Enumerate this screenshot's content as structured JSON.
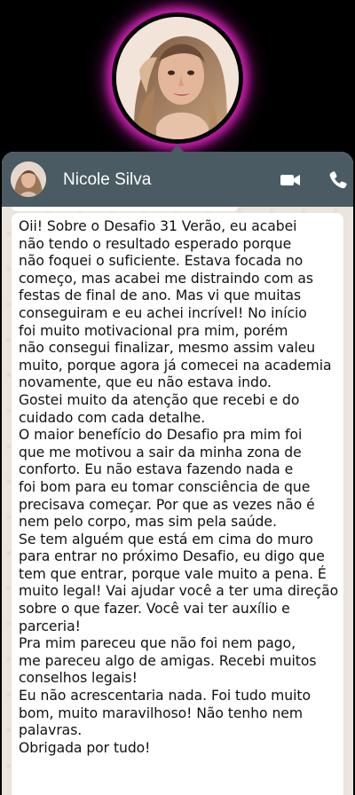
{
  "profile": {
    "photo_icon": "woman-portrait-photo",
    "glow_color": "#d11fb4"
  },
  "header": {
    "contact_name": "Nicole Silva",
    "background_color": "#4a5b63",
    "video_icon": "video-camera-icon",
    "call_icon": "phone-icon"
  },
  "chat": {
    "background_color": "#ece5dd",
    "bubble_color": "#ffffff",
    "message": "Oii! Sobre o Desafio 31 Verão, eu acabei\nnão tendo o resultado esperado porque\nnão foquei o suficiente. Estava focada no\ncomeço, mas acabei me distraindo com as\nfestas de final de ano. Mas vi que muitas\nconseguiram e eu achei incrível! No início\nfoi muito motivacional pra mim, porém\nnão consegui finalizar, mesmo assim valeu\nmuito, porque agora já comecei na academia\nnovamente, que eu não estava indo.\nGostei muito da atenção que recebi e do\ncuidado com cada detalhe.\nO maior benefício do Desafio pra mim foi\nque me motivou a sair da minha zona de\nconforto. Eu não estava fazendo nada e\nfoi bom para eu tomar consciência de que\nprecisava começar. Por que as vezes não é\nnem pelo corpo, mas sim pela saúde.\nSe tem alguém que está em cima do muro\npara entrar no próximo Desafio, eu digo que\ntem que entrar, porque vale muito a pena. É\nmuito legal! Vai ajudar você a ter uma direção\nsobre o que fazer. Você vai ter auxílio e\nparceria!\nPra mim pareceu que não foi nem pago,\nme pareceu algo de amigas. Recebi muitos\nconselhos legais!\nEu não acrescentaria nada. Foi tudo muito\nbom, muito maravilhoso! Não tenho nem\npalavras.\nObrigada por tudo!"
  }
}
